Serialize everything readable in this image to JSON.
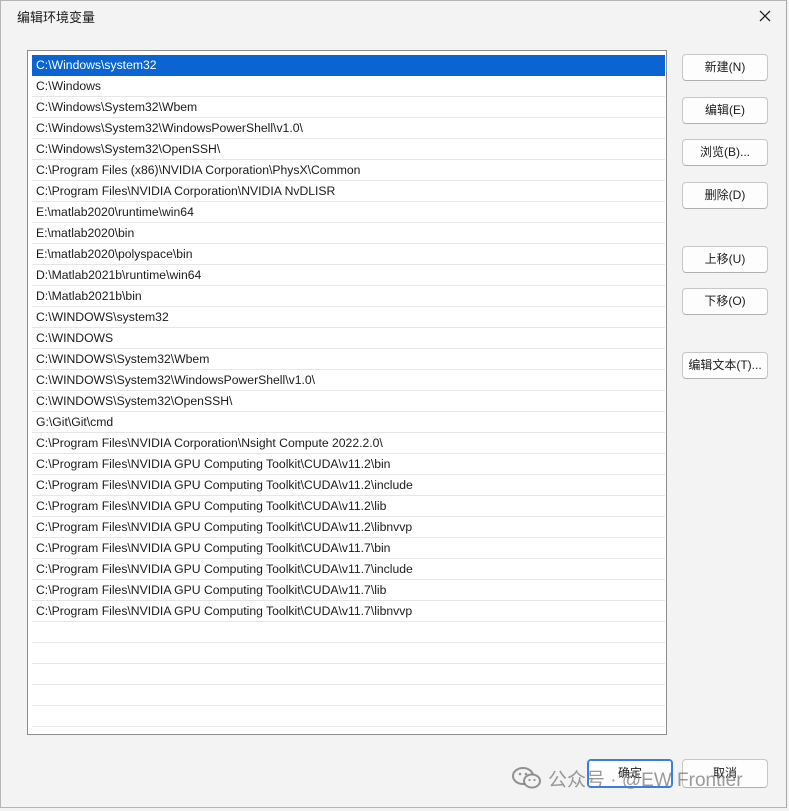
{
  "dialog": {
    "title": "编辑环境变量",
    "close_icon": "close-icon"
  },
  "path_list": {
    "selected_index": 0,
    "items": [
      "C:\\Windows\\system32",
      "C:\\Windows",
      "C:\\Windows\\System32\\Wbem",
      "C:\\Windows\\System32\\WindowsPowerShell\\v1.0\\",
      "C:\\Windows\\System32\\OpenSSH\\",
      "C:\\Program Files (x86)\\NVIDIA Corporation\\PhysX\\Common",
      "C:\\Program Files\\NVIDIA Corporation\\NVIDIA NvDLISR",
      "E:\\matlab2020\\runtime\\win64",
      "E:\\matlab2020\\bin",
      "E:\\matlab2020\\polyspace\\bin",
      "D:\\Matlab2021b\\runtime\\win64",
      "D:\\Matlab2021b\\bin",
      "C:\\WINDOWS\\system32",
      "C:\\WINDOWS",
      "C:\\WINDOWS\\System32\\Wbem",
      "C:\\WINDOWS\\System32\\WindowsPowerShell\\v1.0\\",
      "C:\\WINDOWS\\System32\\OpenSSH\\",
      "G:\\Git\\Git\\cmd",
      "C:\\Program Files\\NVIDIA Corporation\\Nsight Compute 2022.2.0\\",
      "C:\\Program Files\\NVIDIA GPU Computing Toolkit\\CUDA\\v11.2\\bin",
      "C:\\Program Files\\NVIDIA GPU Computing Toolkit\\CUDA\\v11.2\\include",
      "C:\\Program Files\\NVIDIA GPU Computing Toolkit\\CUDA\\v11.2\\lib",
      "C:\\Program Files\\NVIDIA GPU Computing Toolkit\\CUDA\\v11.2\\libnvvp",
      "C:\\Program Files\\NVIDIA GPU Computing Toolkit\\CUDA\\v11.7\\bin",
      "C:\\Program Files\\NVIDIA GPU Computing Toolkit\\CUDA\\v11.7\\include",
      "C:\\Program Files\\NVIDIA GPU Computing Toolkit\\CUDA\\v11.7\\lib",
      "C:\\Program Files\\NVIDIA GPU Computing Toolkit\\CUDA\\v11.7\\libnvvp"
    ],
    "selection_color": "#0a64d2"
  },
  "side_buttons": {
    "new": "新建(N)",
    "edit": "编辑(E)",
    "browse": "浏览(B)...",
    "delete": "删除(D)",
    "move_up": "上移(U)",
    "move_down": "下移(O)",
    "edit_text": "编辑文本(T)..."
  },
  "footer": {
    "ok": "确定",
    "cancel": "取消"
  },
  "watermark": {
    "text": "公众号 · @EW Frontier",
    "logo_icon": "wechat-logo-icon"
  }
}
